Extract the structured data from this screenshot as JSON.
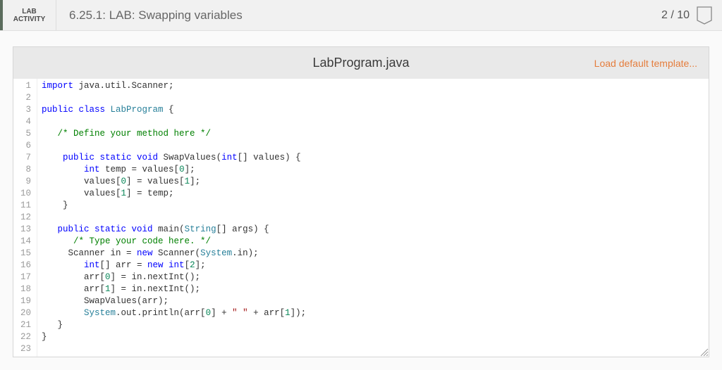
{
  "header": {
    "lab_label_line1": "LAB",
    "lab_label_line2": "ACTIVITY",
    "title": "6.25.1: LAB: Swapping variables",
    "score": "2 / 10"
  },
  "file_header": {
    "filename": "LabProgram.java",
    "load_template_label": "Load default template..."
  },
  "code": {
    "lines": [
      {
        "n": 1,
        "tokens": [
          {
            "t": "import ",
            "c": "kw"
          },
          {
            "t": "java.util.Scanner;",
            "c": "name"
          }
        ]
      },
      {
        "n": 2,
        "tokens": []
      },
      {
        "n": 3,
        "tokens": [
          {
            "t": "public class ",
            "c": "kw"
          },
          {
            "t": "LabProgram",
            "c": "type"
          },
          {
            "t": " {",
            "c": "name"
          }
        ]
      },
      {
        "n": 4,
        "tokens": []
      },
      {
        "n": 5,
        "tokens": [
          {
            "t": "   ",
            "c": "name"
          },
          {
            "t": "/* Define your method here */",
            "c": "cm"
          }
        ]
      },
      {
        "n": 6,
        "tokens": []
      },
      {
        "n": 7,
        "tokens": [
          {
            "t": "    ",
            "c": "name"
          },
          {
            "t": "public static void ",
            "c": "kw"
          },
          {
            "t": "SwapValues",
            "c": "name"
          },
          {
            "t": "(",
            "c": "name"
          },
          {
            "t": "int",
            "c": "kw"
          },
          {
            "t": "[] values) {",
            "c": "name"
          }
        ]
      },
      {
        "n": 8,
        "tokens": [
          {
            "t": "        ",
            "c": "name"
          },
          {
            "t": "int ",
            "c": "kw"
          },
          {
            "t": "temp = values[",
            "c": "name"
          },
          {
            "t": "0",
            "c": "num"
          },
          {
            "t": "];",
            "c": "name"
          }
        ]
      },
      {
        "n": 9,
        "tokens": [
          {
            "t": "        values[",
            "c": "name"
          },
          {
            "t": "0",
            "c": "num"
          },
          {
            "t": "] = values[",
            "c": "name"
          },
          {
            "t": "1",
            "c": "num"
          },
          {
            "t": "];",
            "c": "name"
          }
        ]
      },
      {
        "n": 10,
        "tokens": [
          {
            "t": "        values[",
            "c": "name"
          },
          {
            "t": "1",
            "c": "num"
          },
          {
            "t": "] = temp;",
            "c": "name"
          }
        ]
      },
      {
        "n": 11,
        "tokens": [
          {
            "t": "    }",
            "c": "name"
          }
        ]
      },
      {
        "n": 12,
        "tokens": []
      },
      {
        "n": 13,
        "tokens": [
          {
            "t": "   ",
            "c": "name"
          },
          {
            "t": "public static void ",
            "c": "kw"
          },
          {
            "t": "main",
            "c": "name"
          },
          {
            "t": "(",
            "c": "name"
          },
          {
            "t": "String",
            "c": "type"
          },
          {
            "t": "[] args) {",
            "c": "name"
          }
        ]
      },
      {
        "n": 14,
        "tokens": [
          {
            "t": "      ",
            "c": "name"
          },
          {
            "t": "/* Type your code here. */",
            "c": "cm"
          }
        ]
      },
      {
        "n": 15,
        "tokens": [
          {
            "t": "     Scanner in = ",
            "c": "name"
          },
          {
            "t": "new ",
            "c": "kw"
          },
          {
            "t": "Scanner(",
            "c": "name"
          },
          {
            "t": "System",
            "c": "type"
          },
          {
            "t": ".in);",
            "c": "name"
          }
        ]
      },
      {
        "n": 16,
        "tokens": [
          {
            "t": "        ",
            "c": "name"
          },
          {
            "t": "int",
            "c": "kw"
          },
          {
            "t": "[] arr = ",
            "c": "name"
          },
          {
            "t": "new int",
            "c": "kw"
          },
          {
            "t": "[",
            "c": "name"
          },
          {
            "t": "2",
            "c": "num"
          },
          {
            "t": "];",
            "c": "name"
          }
        ]
      },
      {
        "n": 17,
        "tokens": [
          {
            "t": "        arr[",
            "c": "name"
          },
          {
            "t": "0",
            "c": "num"
          },
          {
            "t": "] = in.nextInt();",
            "c": "name"
          }
        ]
      },
      {
        "n": 18,
        "tokens": [
          {
            "t": "        arr[",
            "c": "name"
          },
          {
            "t": "1",
            "c": "num"
          },
          {
            "t": "] = in.nextInt();",
            "c": "name"
          }
        ]
      },
      {
        "n": 19,
        "tokens": [
          {
            "t": "        SwapValues(arr);",
            "c": "name"
          }
        ]
      },
      {
        "n": 20,
        "tokens": [
          {
            "t": "        ",
            "c": "name"
          },
          {
            "t": "System",
            "c": "type"
          },
          {
            "t": ".out.println(arr[",
            "c": "name"
          },
          {
            "t": "0",
            "c": "num"
          },
          {
            "t": "] + ",
            "c": "name"
          },
          {
            "t": "\" \"",
            "c": "str"
          },
          {
            "t": " + arr[",
            "c": "name"
          },
          {
            "t": "1",
            "c": "num"
          },
          {
            "t": "]);",
            "c": "name"
          }
        ]
      },
      {
        "n": 21,
        "tokens": [
          {
            "t": "   }",
            "c": "name"
          }
        ]
      },
      {
        "n": 22,
        "tokens": [
          {
            "t": "}",
            "c": "name"
          }
        ]
      },
      {
        "n": 23,
        "tokens": []
      }
    ]
  }
}
